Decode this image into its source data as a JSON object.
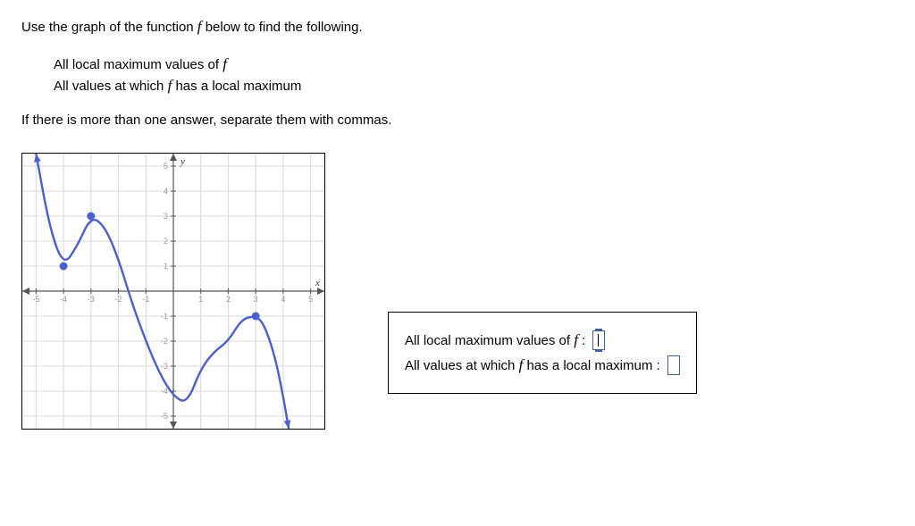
{
  "instruction": "Use the graph of the function ",
  "instruction_f": "f",
  "instruction_end": " below to find the following.",
  "list": {
    "item1_a": "All local maximum values of ",
    "item1_b": "f",
    "item2_a": "All values at which ",
    "item2_b": "f",
    "item2_c": " has a local maximum"
  },
  "instruction2": "If there is more than one answer, separate them with commas.",
  "answers": {
    "row1_a": "All local maximum values of ",
    "row1_b": "f",
    "row1_c": " : ",
    "row2_a": "All values at which ",
    "row2_b": "f",
    "row2_c": " has a local maximum : "
  },
  "chart_data": {
    "type": "line",
    "xlabel": "x",
    "ylabel": "y",
    "xlim": [
      -5.5,
      5.5
    ],
    "ylim": [
      -5.5,
      5.5
    ],
    "x_ticks": [
      -5,
      -4,
      -3,
      -2,
      -1,
      1,
      2,
      3,
      4,
      5
    ],
    "y_ticks": [
      -5,
      -4,
      -3,
      -2,
      -1,
      1,
      2,
      3,
      4,
      5
    ],
    "curve_points": [
      [
        -5,
        5.5
      ],
      [
        -4.5,
        2.5
      ],
      [
        -4,
        1
      ],
      [
        -3.5,
        1.8
      ],
      [
        -3,
        3
      ],
      [
        -2.5,
        2.6
      ],
      [
        -2,
        1.3
      ],
      [
        -1.5,
        -0.5
      ],
      [
        -1,
        -2
      ],
      [
        -0.5,
        -3.3
      ],
      [
        0,
        -4.2
      ],
      [
        0.5,
        -4.5
      ],
      [
        1,
        -3.1
      ],
      [
        1.5,
        -2.4
      ],
      [
        2,
        -2
      ],
      [
        2.5,
        -1.1
      ],
      [
        3,
        -1
      ],
      [
        3.3,
        -1.3
      ],
      [
        3.7,
        -2.6
      ],
      [
        4,
        -4.2
      ],
      [
        4.2,
        -5.5
      ]
    ],
    "marked_points": [
      {
        "x": -4,
        "y": 1
      },
      {
        "x": -3,
        "y": 3
      },
      {
        "x": 3,
        "y": -1
      }
    ],
    "start_arrow": true,
    "end_arrow": true
  }
}
